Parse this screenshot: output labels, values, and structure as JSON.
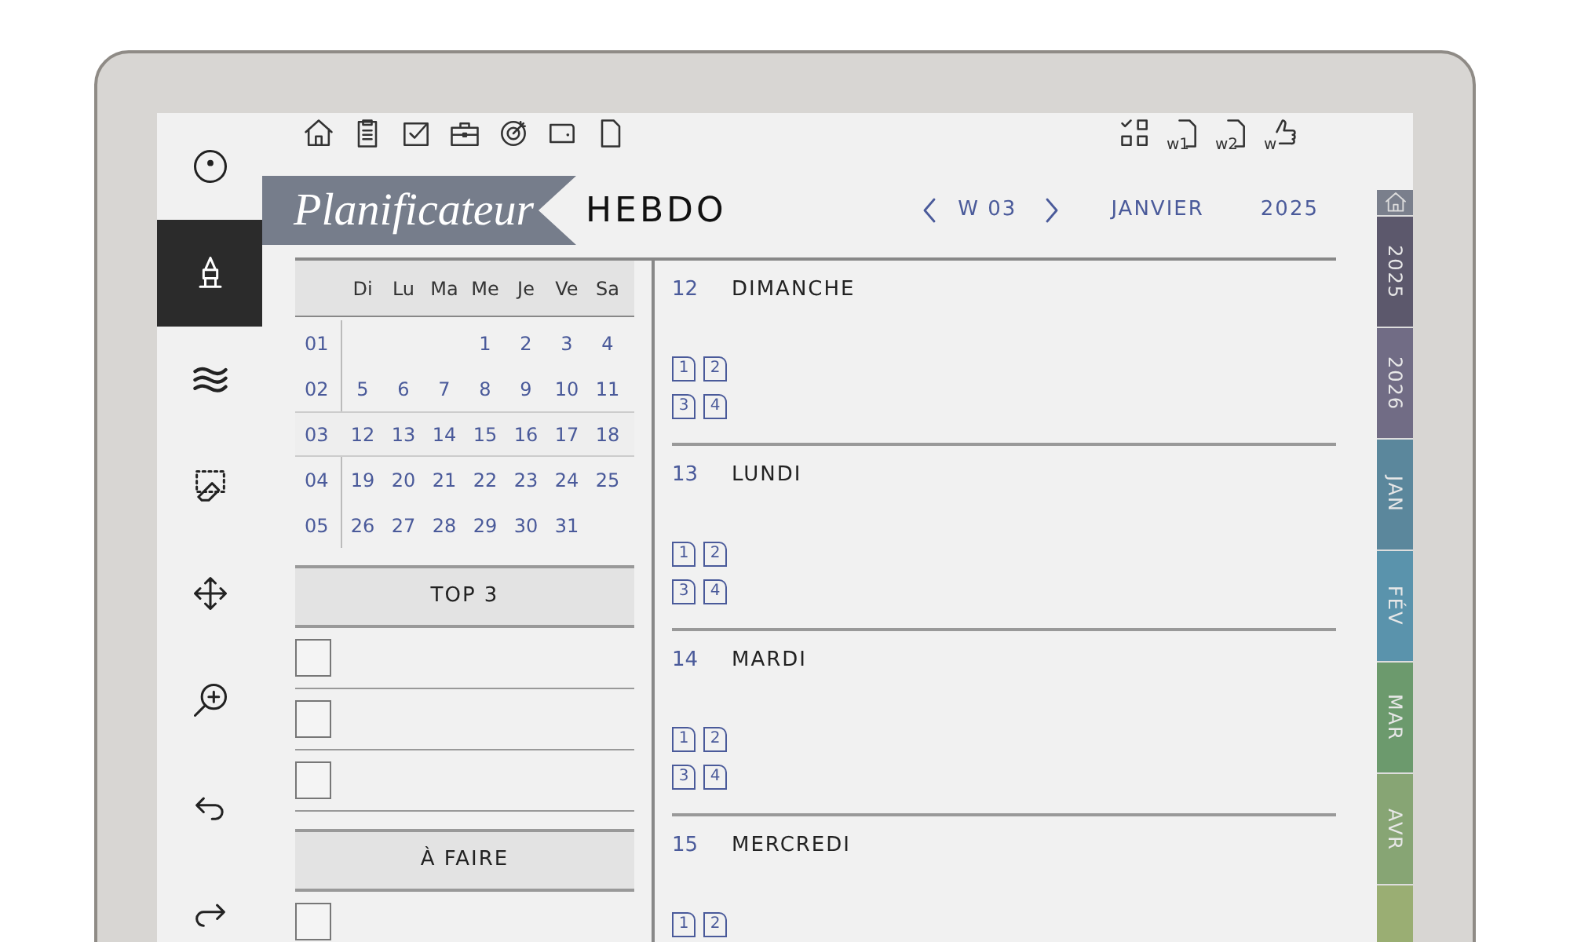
{
  "toolbar": [
    {
      "kind": "circle",
      "selected": false
    },
    {
      "kind": "pen",
      "selected": true
    },
    {
      "kind": "waves",
      "selected": false
    },
    {
      "kind": "eraser",
      "selected": false
    },
    {
      "kind": "move",
      "selected": false
    },
    {
      "kind": "zoom",
      "selected": false
    },
    {
      "kind": "undo",
      "selected": false
    },
    {
      "kind": "redo",
      "selected": false
    }
  ],
  "top_icons": [
    {
      "kind": "home"
    },
    {
      "kind": "clipboard"
    },
    {
      "kind": "check"
    },
    {
      "kind": "briefcase"
    },
    {
      "kind": "target"
    },
    {
      "kind": "wallet"
    },
    {
      "kind": "page"
    }
  ],
  "top_right_icons": [
    {
      "kind": "grid"
    },
    {
      "kind": "week",
      "label": "w1"
    },
    {
      "kind": "week",
      "label": "w2"
    },
    {
      "kind": "thumb",
      "label": "w"
    }
  ],
  "header": {
    "banner": "Planificateur",
    "title": "HEBDO",
    "week": "W 03",
    "month": "JANVIER",
    "year": "2025"
  },
  "calendar": {
    "weekdays": [
      "Di",
      "Lu",
      "Ma",
      "Me",
      "Je",
      "Ve",
      "Sa"
    ],
    "weeks": [
      {
        "week": "01",
        "selected": false,
        "days": [
          {
            "kind": "blank"
          },
          {
            "kind": "blank"
          },
          {
            "kind": "blank"
          },
          {
            "kind": "day",
            "day": "1"
          },
          {
            "kind": "day",
            "day": "2"
          },
          {
            "kind": "day",
            "day": "3"
          },
          {
            "kind": "day",
            "day": "4"
          }
        ]
      },
      {
        "week": "02",
        "selected": false,
        "days": [
          {
            "kind": "day",
            "day": "5"
          },
          {
            "kind": "day",
            "day": "6"
          },
          {
            "kind": "day",
            "day": "7"
          },
          {
            "kind": "day",
            "day": "8"
          },
          {
            "kind": "day",
            "day": "9"
          },
          {
            "kind": "day",
            "day": "10"
          },
          {
            "kind": "day",
            "day": "11"
          }
        ]
      },
      {
        "week": "03",
        "selected": true,
        "days": [
          {
            "kind": "day",
            "day": "12"
          },
          {
            "kind": "day",
            "day": "13"
          },
          {
            "kind": "day",
            "day": "14"
          },
          {
            "kind": "day",
            "day": "15"
          },
          {
            "kind": "day",
            "day": "16"
          },
          {
            "kind": "day",
            "day": "17"
          },
          {
            "kind": "day",
            "day": "18"
          }
        ]
      },
      {
        "week": "04",
        "selected": false,
        "days": [
          {
            "kind": "day",
            "day": "19"
          },
          {
            "kind": "day",
            "day": "20"
          },
          {
            "kind": "day",
            "day": "21"
          },
          {
            "kind": "day",
            "day": "22"
          },
          {
            "kind": "day",
            "day": "23"
          },
          {
            "kind": "day",
            "day": "24"
          },
          {
            "kind": "day",
            "day": "25"
          }
        ]
      },
      {
        "week": "05",
        "selected": false,
        "days": [
          {
            "kind": "day",
            "day": "26"
          },
          {
            "kind": "day",
            "day": "27"
          },
          {
            "kind": "day",
            "day": "28"
          },
          {
            "kind": "day",
            "day": "29"
          },
          {
            "kind": "day",
            "day": "30"
          },
          {
            "kind": "day",
            "day": "31"
          },
          {
            "kind": "blank"
          }
        ]
      }
    ]
  },
  "top3": {
    "title": "TOP 3",
    "items": [
      {
        "checked": false
      },
      {
        "checked": false
      },
      {
        "checked": false
      }
    ]
  },
  "todo": {
    "title": "À FAIRE",
    "items": [
      {
        "checked": false
      }
    ]
  },
  "days": [
    {
      "date": "12",
      "name": "DIMANCHE",
      "notes": [
        "1",
        "2",
        "3",
        "4"
      ]
    },
    {
      "date": "13",
      "name": "LUNDI",
      "notes": [
        "1",
        "2",
        "3",
        "4"
      ]
    },
    {
      "date": "14",
      "name": "MARDI",
      "notes": [
        "1",
        "2",
        "3",
        "4"
      ]
    },
    {
      "date": "15",
      "name": "MERCREDI",
      "notes": [
        "1",
        "2"
      ]
    }
  ],
  "side_tabs": [
    {
      "kind": "home",
      "color": "#7a7f8c"
    },
    {
      "kind": "label",
      "label": "2025",
      "color": "#5c586c"
    },
    {
      "kind": "label",
      "label": "2026",
      "color": "#716c85"
    },
    {
      "kind": "label",
      "label": "JAN",
      "color": "#5b879c"
    },
    {
      "kind": "label",
      "label": "FÉV",
      "color": "#5a93ac"
    },
    {
      "kind": "label",
      "label": "MAR",
      "color": "#6c9a6d"
    },
    {
      "kind": "label",
      "label": "AVR",
      "color": "#87a574"
    },
    {
      "kind": "label",
      "color": "#9aae73"
    }
  ]
}
